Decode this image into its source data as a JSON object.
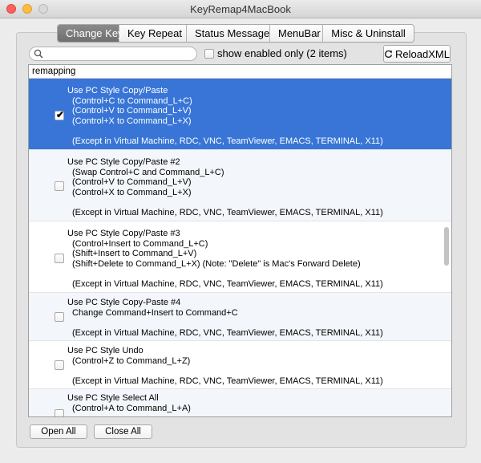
{
  "window": {
    "title": "KeyRemap4MacBook"
  },
  "tabs": [
    "Change Key",
    "Key Repeat",
    "Status Message",
    "MenuBar",
    "Misc & Uninstall"
  ],
  "search": {
    "value": "",
    "placeholder": ""
  },
  "filter": {
    "label": "show enabled only (2 items)",
    "checked": false
  },
  "reload_label": "ReloadXML",
  "list": {
    "header": "remapping",
    "items": [
      {
        "title": "Use PC Style Copy/Paste",
        "lines": [
          "(Control+C to Command_L+C)",
          "(Control+V to Command_L+V)",
          "(Control+X to Command_L+X)"
        ],
        "note": "(Except in Virtual Machine, RDC, VNC, TeamViewer, EMACS, TERMINAL, X11)",
        "checked": true,
        "selected": true
      },
      {
        "title": "Use PC Style Copy/Paste #2",
        "lines": [
          "(Swap Control+C and Command_L+C)",
          "(Control+V to Command_L+V)",
          "(Control+X to Command_L+X)"
        ],
        "note": "(Except in Virtual Machine, RDC, VNC, TeamViewer, EMACS, TERMINAL, X11)",
        "checked": false,
        "selected": false
      },
      {
        "title": "Use PC Style Copy/Paste #3",
        "lines": [
          "(Control+Insert to Command_L+C)",
          "(Shift+Insert to Command_L+V)",
          "(Shift+Delete to Command_L+X) (Note: \"Delete\" is Mac's Forward Delete)"
        ],
        "note": "(Except in Virtual Machine, RDC, VNC, TeamViewer, EMACS, TERMINAL, X11)",
        "checked": false,
        "selected": false
      },
      {
        "title": "Use PC Style Copy-Paste #4",
        "lines": [
          "Change Command+Insert to Command+C"
        ],
        "note": "(Except in Virtual Machine, RDC, VNC, TeamViewer, EMACS, TERMINAL, X11)",
        "checked": false,
        "selected": false
      },
      {
        "title": "Use PC Style Undo",
        "lines": [
          "(Control+Z to Command_L+Z)"
        ],
        "note": "(Except in Virtual Machine, RDC, VNC, TeamViewer, EMACS, TERMINAL, X11)",
        "checked": false,
        "selected": false
      },
      {
        "title": "Use PC Style Select All",
        "lines": [
          "(Control+A to Command_L+A)"
        ],
        "note": "",
        "checked": false,
        "selected": false
      }
    ]
  },
  "buttons": {
    "open_all": "Open All",
    "close_all": "Close All"
  },
  "icons": {
    "search": "search-icon",
    "reload": "reload-icon",
    "check": "checkmark-icon"
  },
  "colors": {
    "selection": "#3875d7",
    "active_tab": "#7a7a7a"
  }
}
